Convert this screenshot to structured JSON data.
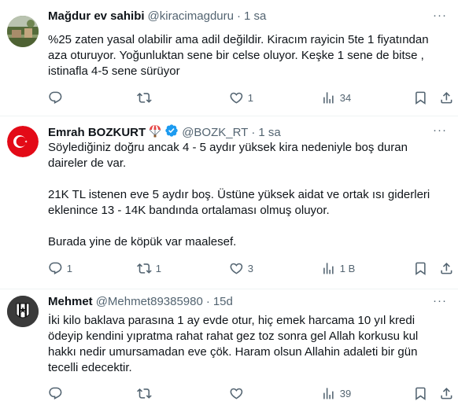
{
  "tweets": [
    {
      "name": "Mağdur ev sahibi",
      "handle": "@kiracimagduru",
      "dot": "·",
      "time": "1 sa",
      "more": "···",
      "paragraphs": [
        "%25 zaten yasal olabilir ama adil değildir. Kiracım rayicin 5te 1 fiyatından aza oturuyor. Yoğunluktan sene bir celse oluyor. Keşke 1 sene de bitse , istinafla 4-5 sene sürüyor"
      ],
      "replies": "",
      "retweets": "",
      "likes": "1",
      "views": "34",
      "avatar_icon": "landscape-photo-icon",
      "verified": false,
      "emoji": ""
    },
    {
      "name": "Emrah BOZKURT",
      "handle": "@BOZK_RT",
      "dot": "·",
      "time": "1 sa",
      "more": "···",
      "paragraphs": [
        "Söylediğiniz doğru ancak 4 - 5 aydır yüksek kira nedeniyle boş duran daireler de var.",
        "21K TL istenen eve 5 aydır boş. Üstüne yüksek aidat ve ortak ısı giderleri eklenince 13 - 14K bandında ortalaması olmuş oluyor.",
        "Burada yine de köpük var maalesef."
      ],
      "replies": "1",
      "retweets": "1",
      "likes": "3",
      "views": "1 B",
      "avatar_icon": "turkish-flag-icon",
      "verified": true,
      "emoji": "parachute-icon"
    },
    {
      "name": "Mehmet",
      "handle": "@Mehmet89385980",
      "dot": "·",
      "time": "15d",
      "more": "···",
      "paragraphs": [
        "İki kilo baklava parasına 1 ay evde otur, hiç emek harcama 10 yıl kredi ödeyip kendini yıpratma rahat rahat gez toz sonra gel Allah korkusu kul hakkı nedir umursamadan eve çök. Haram olsun Allahin adaleti bir gün tecelli edecektir."
      ],
      "replies": "",
      "retweets": "",
      "likes": "",
      "views": "39",
      "avatar_icon": "club-crest-icon",
      "verified": false,
      "emoji": ""
    }
  ],
  "colors": {
    "text": "#0f1419",
    "secondary": "#536471",
    "divider": "#eff3f4",
    "verified": "#1d9bf0",
    "flag_red": "#e30a17"
  }
}
